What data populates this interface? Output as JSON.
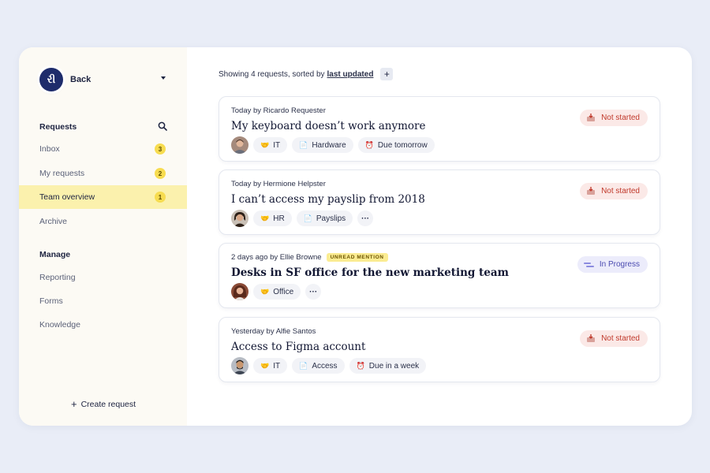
{
  "sidebar": {
    "logo_glyph": "રી",
    "brand_label": "Back",
    "requests_title": "Requests",
    "requests_items": [
      {
        "label": "Inbox",
        "badge": "3"
      },
      {
        "label": "My requests",
        "badge": "2"
      },
      {
        "label": "Team overview",
        "badge": "1"
      },
      {
        "label": "Archive",
        "badge": ""
      }
    ],
    "manage_title": "Manage",
    "manage_items": [
      {
        "label": "Reporting"
      },
      {
        "label": "Forms"
      },
      {
        "label": "Knowledge"
      }
    ],
    "create_label": "Create request",
    "create_glyph": "+"
  },
  "main": {
    "summary_text": "Showing 4 requests, sorted by",
    "sort_label": "last updated",
    "add_glyph": "+"
  },
  "requests": [
    {
      "meta": "Today by Ricardo Requester",
      "title": "My keyboard doesn’t work anymore",
      "tags": [
        {
          "icon": "🤝",
          "label": "IT"
        },
        {
          "icon": "📄",
          "label": "Hardware"
        },
        {
          "icon": "⏰",
          "label": "Due tomorrow"
        }
      ],
      "status": "Not started"
    },
    {
      "meta": "Today by Hermione Helpster",
      "title": "I can’t access my payslip from 2018",
      "tags": [
        {
          "icon": "🤝",
          "label": "HR"
        },
        {
          "icon": "📄",
          "label": "Payslips"
        }
      ],
      "more": "···",
      "status": "Not started"
    },
    {
      "meta": "2 days ago by Ellie Browne",
      "mention": "UNREAD MENTION",
      "title": "Desks in SF office for the new marketing team",
      "tags": [
        {
          "icon": "🤝",
          "label": "Office"
        }
      ],
      "more": "···",
      "status": "In Progress"
    },
    {
      "meta": "Yesterday by Alfie Santos",
      "title": "Access to Figma account",
      "tags": [
        {
          "icon": "🤝",
          "label": "IT"
        },
        {
          "icon": "📄",
          "label": "Access"
        },
        {
          "icon": "⏰",
          "label": "Due in a week"
        }
      ],
      "status": "Not started"
    }
  ],
  "colors": {
    "page_bg": "#e9edf7",
    "sidebar_bg": "#fcfaf4",
    "active_bg": "#fbf1ad",
    "badge_bg": "#f7dc50",
    "logo_bg": "#1e2c6b",
    "not_started_bg": "#fbe9e7",
    "not_started_text": "#c0392b",
    "in_progress_bg": "#ececfb",
    "in_progress_text": "#4a4ab0"
  }
}
